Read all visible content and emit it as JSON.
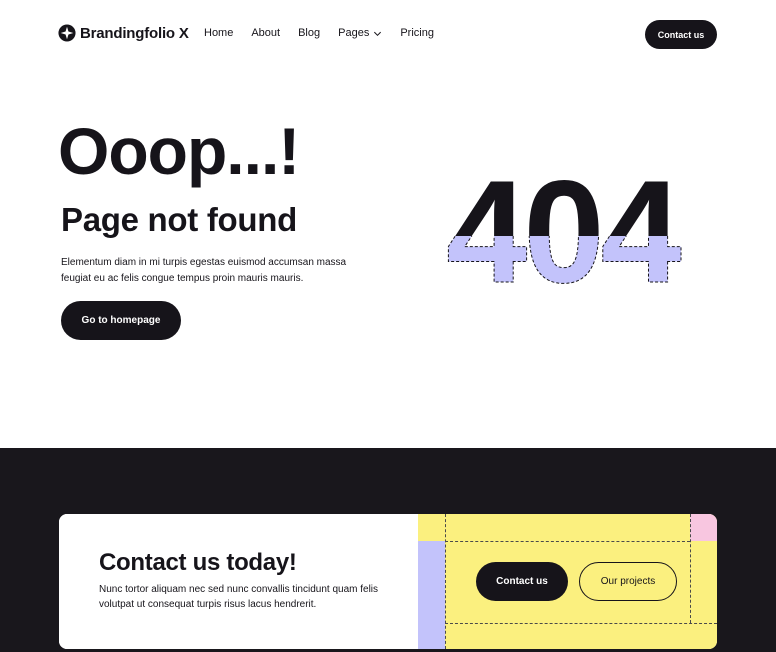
{
  "brand": {
    "name": "Brandingfolio X",
    "icon": "sparkle-icon"
  },
  "nav": {
    "items": [
      {
        "label": "Home"
      },
      {
        "label": "About"
      },
      {
        "label": "Blog"
      },
      {
        "label": "Pages",
        "icon": "chevron-down-icon"
      },
      {
        "label": "Pricing"
      }
    ],
    "contact_label": "Contact us"
  },
  "hero": {
    "title": "Ooop...!",
    "subtitle": "Page not found",
    "text": "Elementum diam in mi turpis egestas euismod accumsan massa feugiat eu ac felis congue tempus proin mauris mauris.",
    "button_label": "Go to homepage",
    "art_text": "404"
  },
  "cta": {
    "title": "Contact us today!",
    "text": "Nunc tortor aliquam nec sed nunc convallis tincidunt quam felis volutpat ut consequat turpis risus lacus hendrerit.",
    "primary_label": "Contact us",
    "secondary_label": "Our projects"
  },
  "colors": {
    "dark": "#16141a",
    "lavender": "#c3c3fb",
    "yellow": "#fbf07f",
    "pink": "#f8c6e0",
    "white": "#ffffff"
  }
}
